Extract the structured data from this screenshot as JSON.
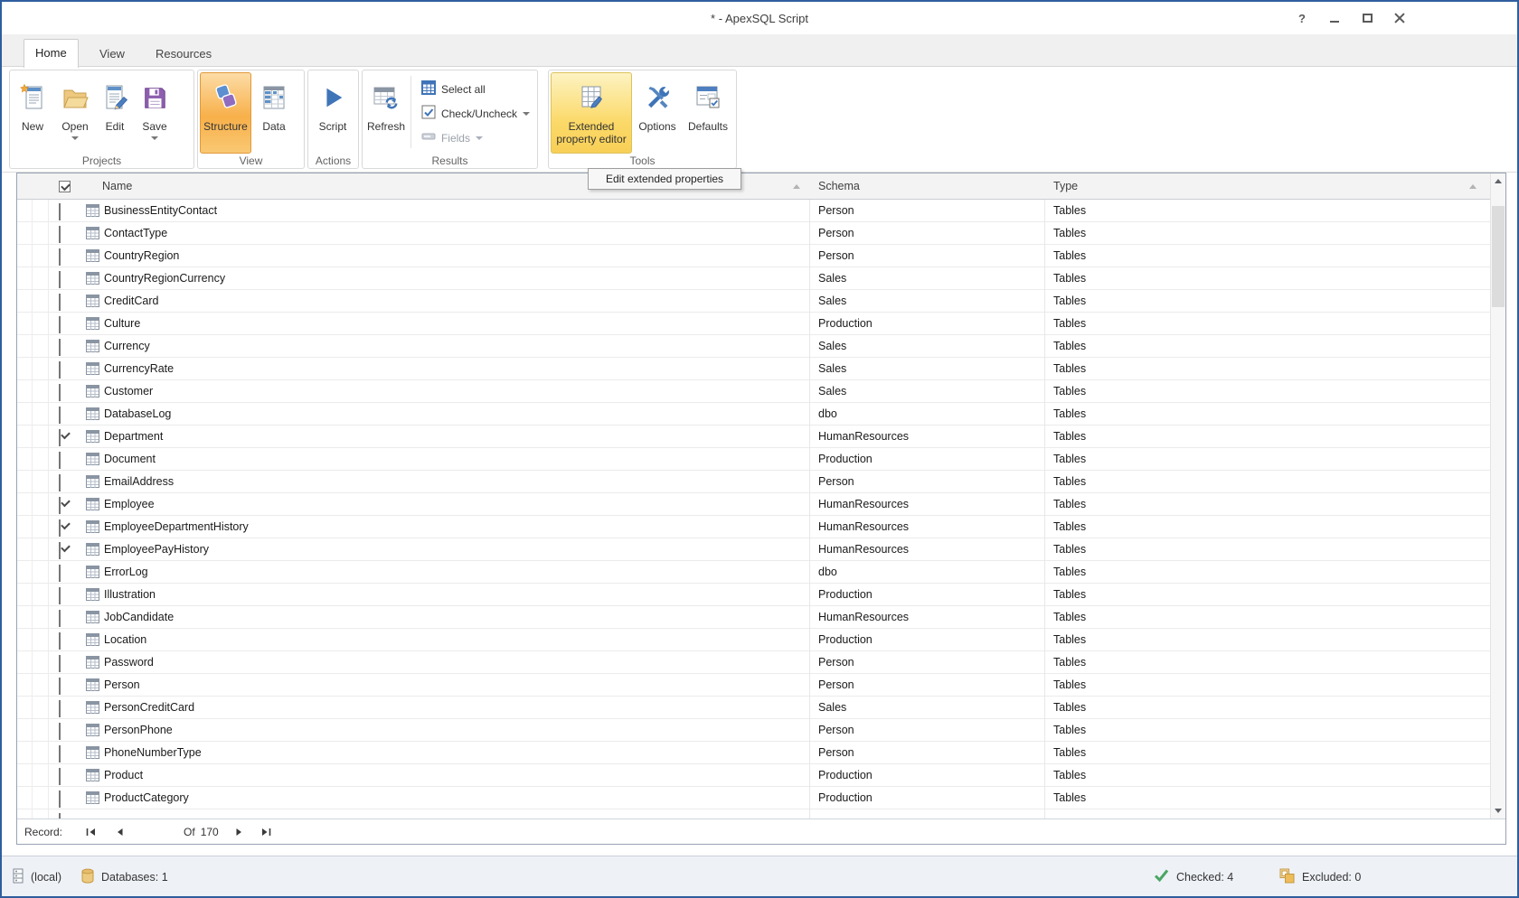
{
  "window": {
    "title": "* - ApexSQL Script",
    "help_glyph": "?"
  },
  "tabs": {
    "home": "Home",
    "view": "View",
    "resources": "Resources"
  },
  "ribbon": {
    "projects": {
      "label": "Projects",
      "new": "New",
      "open": "Open",
      "edit": "Edit",
      "save": "Save"
    },
    "view": {
      "label": "View",
      "structure": "Structure",
      "data": "Data"
    },
    "actions": {
      "label": "Actions",
      "script": "Script"
    },
    "results": {
      "label": "Results",
      "refresh": "Refresh",
      "select_all": "Select all",
      "check_uncheck": "Check/Uncheck",
      "fields": "Fields"
    },
    "tools": {
      "label": "Tools",
      "extended_property_editor": "Extended property editor",
      "options": "Options",
      "defaults": "Defaults"
    }
  },
  "tooltip": {
    "text": "Edit extended properties"
  },
  "grid": {
    "columns": {
      "name": "Name",
      "schema": "Schema",
      "type": "Type"
    },
    "header_checkbox_checked": true,
    "rows": [
      {
        "name": "BusinessEntityContact",
        "schema": "Person",
        "type": "Tables",
        "checked": false
      },
      {
        "name": "ContactType",
        "schema": "Person",
        "type": "Tables",
        "checked": false
      },
      {
        "name": "CountryRegion",
        "schema": "Person",
        "type": "Tables",
        "checked": false
      },
      {
        "name": "CountryRegionCurrency",
        "schema": "Sales",
        "type": "Tables",
        "checked": false
      },
      {
        "name": "CreditCard",
        "schema": "Sales",
        "type": "Tables",
        "checked": false
      },
      {
        "name": "Culture",
        "schema": "Production",
        "type": "Tables",
        "checked": false
      },
      {
        "name": "Currency",
        "schema": "Sales",
        "type": "Tables",
        "checked": false
      },
      {
        "name": "CurrencyRate",
        "schema": "Sales",
        "type": "Tables",
        "checked": false
      },
      {
        "name": "Customer",
        "schema": "Sales",
        "type": "Tables",
        "checked": false
      },
      {
        "name": "DatabaseLog",
        "schema": "dbo",
        "type": "Tables",
        "checked": false
      },
      {
        "name": "Department",
        "schema": "HumanResources",
        "type": "Tables",
        "checked": true
      },
      {
        "name": "Document",
        "schema": "Production",
        "type": "Tables",
        "checked": false
      },
      {
        "name": "EmailAddress",
        "schema": "Person",
        "type": "Tables",
        "checked": false
      },
      {
        "name": "Employee",
        "schema": "HumanResources",
        "type": "Tables",
        "checked": true
      },
      {
        "name": "EmployeeDepartmentHistory",
        "schema": "HumanResources",
        "type": "Tables",
        "checked": true
      },
      {
        "name": "EmployeePayHistory",
        "schema": "HumanResources",
        "type": "Tables",
        "checked": true
      },
      {
        "name": "ErrorLog",
        "schema": "dbo",
        "type": "Tables",
        "checked": false
      },
      {
        "name": "Illustration",
        "schema": "Production",
        "type": "Tables",
        "checked": false
      },
      {
        "name": "JobCandidate",
        "schema": "HumanResources",
        "type": "Tables",
        "checked": false
      },
      {
        "name": "Location",
        "schema": "Production",
        "type": "Tables",
        "checked": false
      },
      {
        "name": "Password",
        "schema": "Person",
        "type": "Tables",
        "checked": false
      },
      {
        "name": "Person",
        "schema": "Person",
        "type": "Tables",
        "checked": false
      },
      {
        "name": "PersonCreditCard",
        "schema": "Sales",
        "type": "Tables",
        "checked": false
      },
      {
        "name": "PersonPhone",
        "schema": "Person",
        "type": "Tables",
        "checked": false
      },
      {
        "name": "PhoneNumberType",
        "schema": "Person",
        "type": "Tables",
        "checked": false
      },
      {
        "name": "Product",
        "schema": "Production",
        "type": "Tables",
        "checked": false
      },
      {
        "name": "ProductCategory",
        "schema": "Production",
        "type": "Tables",
        "checked": false
      }
    ]
  },
  "record_navigator": {
    "record_label": "Record:",
    "of_label": "Of",
    "total": "170"
  },
  "status_bar": {
    "server": "(local)",
    "databases": "Databases: 1",
    "checked": "Checked: 4",
    "excluded": "Excluded: 0"
  },
  "colors": {
    "window_border": "#2f5e9e",
    "selected_orange": "#f8b04a",
    "hover_yellow": "#fbd968",
    "accent_blue": "#3f74b8",
    "check_green": "#4aa564",
    "excluded_tan": "#eebc5a"
  }
}
